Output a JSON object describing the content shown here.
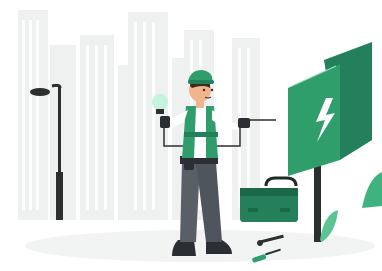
{
  "illustration": {
    "icon": "electrician-illustration",
    "colors": {
      "background": "#ffffff",
      "ground": "#f1f4f2",
      "city": "#eef1ef",
      "city_windows": "#ffffff",
      "accent_green": "#2f9e6b",
      "accent_green_dark": "#23805a",
      "lamp": "#2b2f2d",
      "skin": "#f2b48e",
      "hair": "#3a2a22",
      "pants": "#585f66",
      "boots": "#2b2f33",
      "bulb": "#c6f3dd",
      "plant": "#3fb37f"
    },
    "elements": {
      "cityscape": "city-skyline",
      "street_lamp": "street-lamp-icon",
      "worker": "electrician-worker",
      "light_bulb": "light-bulb-icon",
      "electric_box": "electrical-panel-icon",
      "lightning": "lightning-bolt-icon",
      "toolbox": "toolbox-icon",
      "wrench": "wrench-icon",
      "screwdriver": "screwdriver-icon",
      "plant": "leaf-plant-icon"
    }
  }
}
